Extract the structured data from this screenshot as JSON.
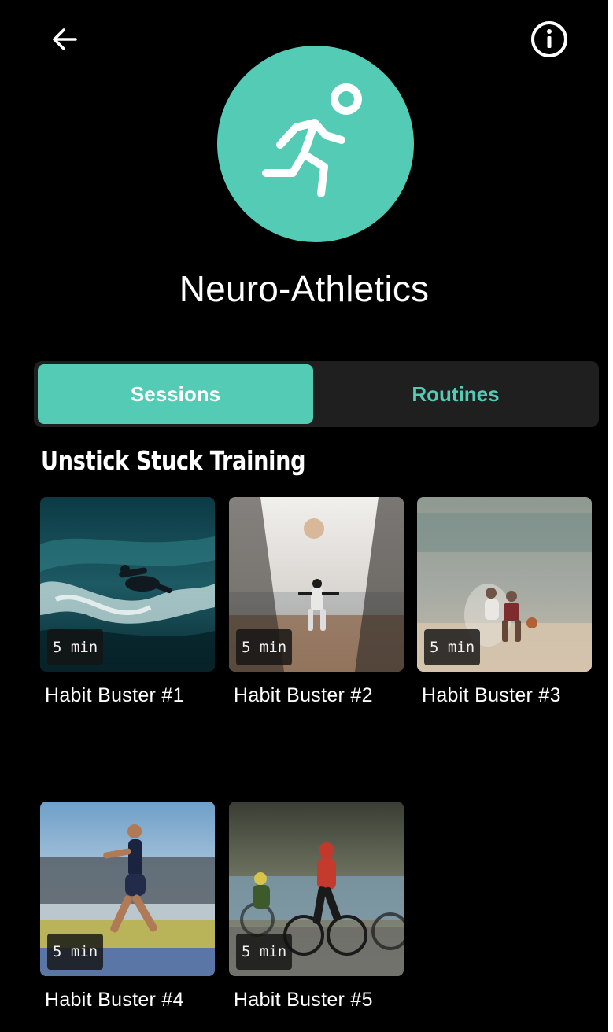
{
  "colors": {
    "accent": "#53cbb5",
    "background": "#000000",
    "tab_track": "#1f1f1f",
    "text": "#ffffff"
  },
  "header": {
    "back_icon": "arrow-left-icon",
    "info_icon": "info-circle-icon"
  },
  "hero": {
    "icon": "running-person-icon",
    "title": "Neuro-Athletics"
  },
  "tabs": [
    {
      "label": "Sessions",
      "selected": true
    },
    {
      "label": "Routines",
      "selected": false
    }
  ],
  "section": {
    "title": "Unstick Stuck Training"
  },
  "sessions": [
    {
      "title": "Habit Buster #1",
      "duration": "5 min",
      "image": "surfer-photo"
    },
    {
      "title": "Habit Buster #2",
      "duration": "5 min",
      "image": "baseball-pitcher-photo"
    },
    {
      "title": "Habit Buster #3",
      "duration": "5 min",
      "image": "basketball-players-photo"
    },
    {
      "title": "Habit Buster #4",
      "duration": "5 min",
      "image": "sprinter-photo"
    },
    {
      "title": "Habit Buster #5",
      "duration": "5 min",
      "image": "cyclists-photo"
    }
  ]
}
